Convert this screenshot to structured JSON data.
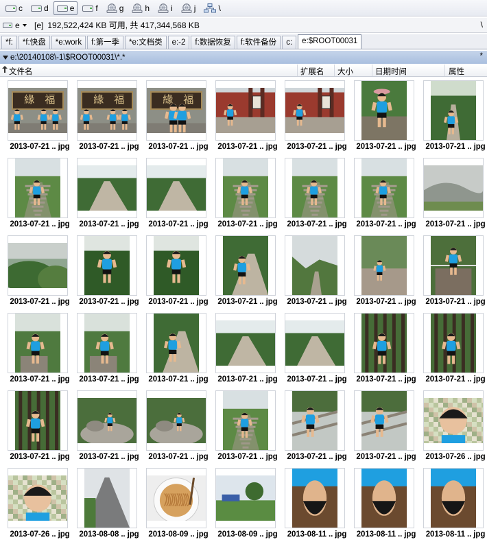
{
  "drives": [
    {
      "label": "c",
      "icon": "disk-icon",
      "active": false
    },
    {
      "label": "d",
      "icon": "disk-icon",
      "active": false
    },
    {
      "label": "e",
      "icon": "disk-icon",
      "active": true
    },
    {
      "label": "f",
      "icon": "disk-icon",
      "active": false
    },
    {
      "label": "g",
      "icon": "network-drive-icon",
      "active": false
    },
    {
      "label": "h",
      "icon": "network-drive-icon",
      "active": false
    },
    {
      "label": "i",
      "icon": "network-drive-icon",
      "active": false
    },
    {
      "label": "j",
      "icon": "network-drive-icon",
      "active": false
    },
    {
      "label": "\\",
      "icon": "network-icon",
      "active": false
    }
  ],
  "info": {
    "drive_select": "e",
    "volume_label": "[e]",
    "free_space": "192,522,424 KB 可用, 共 417,344,568 KB",
    "right_label": "\\"
  },
  "tabs": [
    {
      "label": "*f:",
      "active": false
    },
    {
      "label": "*f:快盘",
      "active": false
    },
    {
      "label": "*e:work",
      "active": false
    },
    {
      "label": "f:第一季",
      "active": false
    },
    {
      "label": "*e:文档类",
      "active": false
    },
    {
      "label": "e:-2",
      "active": false
    },
    {
      "label": "f:数据恢复",
      "active": false
    },
    {
      "label": "f:软件备份",
      "active": false
    },
    {
      "label": "c:",
      "active": false
    },
    {
      "label": "e:$ROOT00031",
      "active": true
    }
  ],
  "path": {
    "text": "e:\\20140108\\-1\\$ROOT00031\\*.*",
    "star": "*"
  },
  "columns": {
    "name": "文件名",
    "ext": "扩展名",
    "size": "大小",
    "date": "日期时间",
    "attr": "属性"
  },
  "files": [
    {
      "name": "2013-07-21 .. jpg",
      "scene": "signboard"
    },
    {
      "name": "2013-07-21 .. jpg",
      "scene": "signboard"
    },
    {
      "name": "2013-07-21 .. jpg",
      "scene": "signboard-close"
    },
    {
      "name": "2013-07-21 .. jpg",
      "scene": "red-gate"
    },
    {
      "name": "2013-07-21 .. jpg",
      "scene": "red-gate"
    },
    {
      "name": "2013-07-21 .. jpg",
      "scene": "hat-portrait"
    },
    {
      "name": "2013-07-21 .. jpg",
      "scene": "forest-path-person"
    },
    {
      "name": "2013-07-21 .. jpg",
      "scene": "steps-person"
    },
    {
      "name": "2013-07-21 .. jpg",
      "scene": "path"
    },
    {
      "name": "2013-07-21 .. jpg",
      "scene": "path"
    },
    {
      "name": "2013-07-21 .. jpg",
      "scene": "stairs-person"
    },
    {
      "name": "2013-07-21 .. jpg",
      "scene": "stairs-person"
    },
    {
      "name": "2013-07-21 .. jpg",
      "scene": "stairs-person"
    },
    {
      "name": "2013-07-21 .. jpg",
      "scene": "mountain-haze"
    },
    {
      "name": "2013-07-21 .. jpg",
      "scene": "greenery"
    },
    {
      "name": "2013-07-21 .. jpg",
      "scene": "person-foliage"
    },
    {
      "name": "2013-07-21 .. jpg",
      "scene": "person-foliage"
    },
    {
      "name": "2013-07-21 .. jpg",
      "scene": "person-path"
    },
    {
      "name": "2013-07-21 .. jpg",
      "scene": "valley"
    },
    {
      "name": "2013-07-21 .. jpg",
      "scene": "rocks-person"
    },
    {
      "name": "2013-07-21 .. jpg",
      "scene": "bridge-person"
    },
    {
      "name": "2013-07-21 .. jpg",
      "scene": "person-stone"
    },
    {
      "name": "2013-07-21 .. jpg",
      "scene": "person-stone"
    },
    {
      "name": "2013-07-21 .. jpg",
      "scene": "person-path"
    },
    {
      "name": "2013-07-21 .. jpg",
      "scene": "path"
    },
    {
      "name": "2013-07-21 .. jpg",
      "scene": "path"
    },
    {
      "name": "2013-07-21 .. jpg",
      "scene": "person-trees"
    },
    {
      "name": "2013-07-21 .. jpg",
      "scene": "person-trees"
    },
    {
      "name": "2013-07-21 .. jpg",
      "scene": "person-trees"
    },
    {
      "name": "2013-07-21 .. jpg",
      "scene": "rocks-garden"
    },
    {
      "name": "2013-07-21 .. jpg",
      "scene": "rocks-garden"
    },
    {
      "name": "2013-07-21 .. jpg",
      "scene": "stairs-person"
    },
    {
      "name": "2013-07-21 .. jpg",
      "scene": "railing-person"
    },
    {
      "name": "2013-07-21 .. jpg",
      "scene": "railing-person"
    },
    {
      "name": "2013-07-26 .. jpg",
      "scene": "face-pixelated"
    },
    {
      "name": "2013-07-26 .. jpg",
      "scene": "face-pixelated"
    },
    {
      "name": "2013-08-08 .. jpg",
      "scene": "road"
    },
    {
      "name": "2013-08-09 .. jpg",
      "scene": "noodles"
    },
    {
      "name": "2013-08-09 .. jpg",
      "scene": "square"
    },
    {
      "name": "2013-08-11 .. jpg",
      "scene": "face-upside"
    },
    {
      "name": "2013-08-11 .. jpg",
      "scene": "face-upside"
    },
    {
      "name": "2013-08-11 .. jpg",
      "scene": "face-upside"
    }
  ]
}
